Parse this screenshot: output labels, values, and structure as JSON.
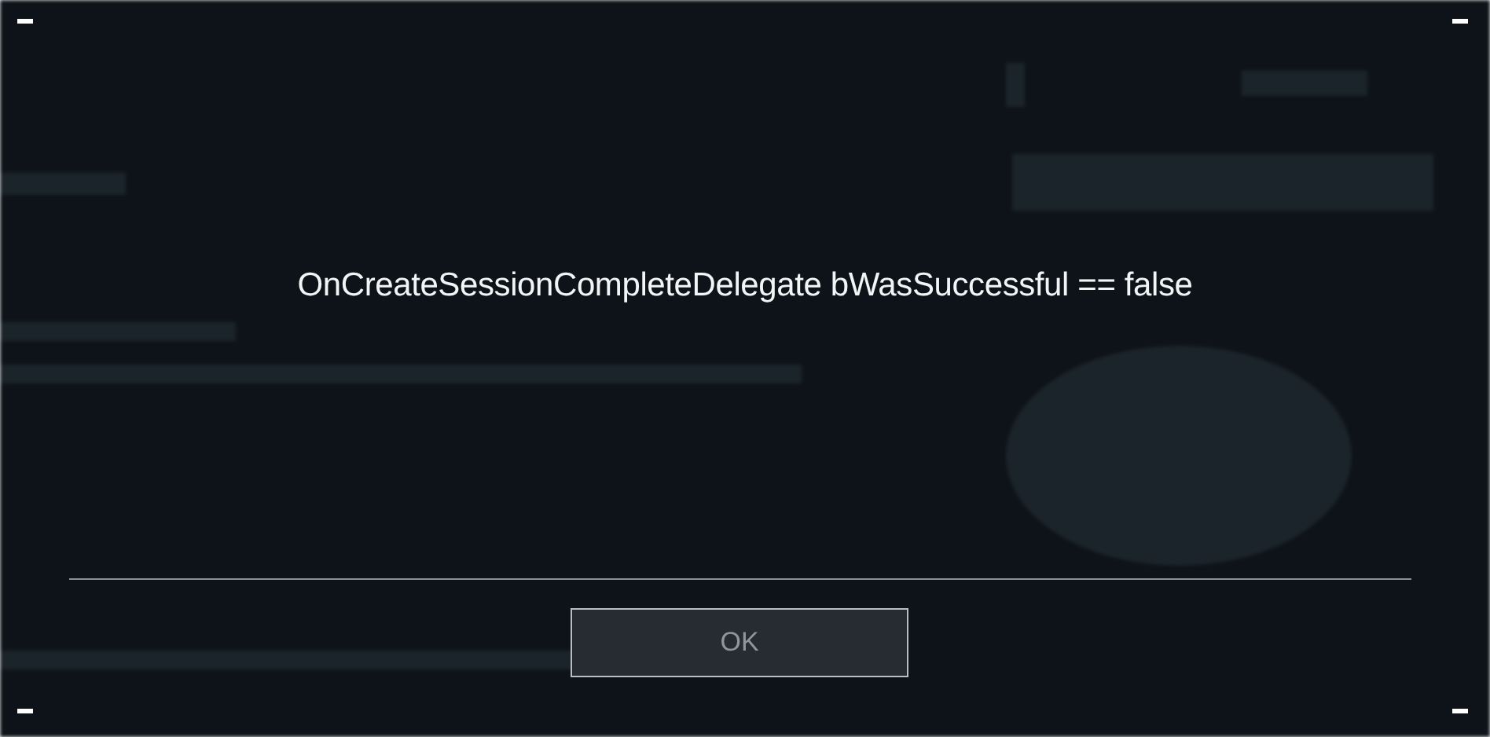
{
  "dialog": {
    "message": "OnCreateSessionCompleteDelegate bWasSuccessful == false",
    "buttons": [
      {
        "label": "OK",
        "disabled": true
      }
    ]
  }
}
